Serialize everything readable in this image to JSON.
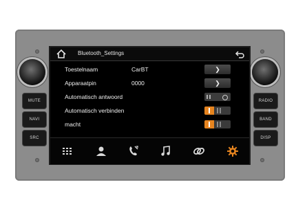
{
  "hardware": {
    "left_buttons": [
      "MUTE",
      "NAVI",
      "SRC"
    ],
    "right_buttons": [
      "RADIO",
      "BAND",
      "DISP"
    ]
  },
  "screen": {
    "title": "Bluetooth_Settings",
    "rows": [
      {
        "label": "Toestelnaam",
        "value": "CarBT",
        "control": "arrow"
      },
      {
        "label": "Apparaatpin",
        "value": "0000",
        "control": "arrow"
      },
      {
        "label": "Automatisch antwoord",
        "value": "",
        "control": "toggle",
        "state": "off"
      },
      {
        "label": "Automatisch verbinden",
        "value": "",
        "control": "toggle",
        "state": "on"
      },
      {
        "label": "macht",
        "value": "",
        "control": "toggle",
        "state": "on"
      }
    ],
    "arrow_glyph": "❯",
    "dock": [
      "apps-grid-icon",
      "contacts-icon",
      "call-log-icon",
      "music-icon",
      "link-icon",
      "settings-gear-icon"
    ],
    "accent_color": "#e6841f"
  }
}
